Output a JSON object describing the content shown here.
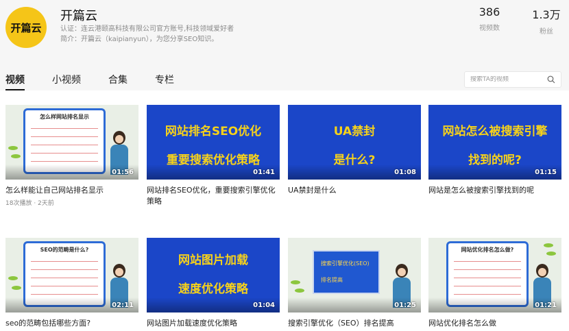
{
  "profile": {
    "avatar_text": "开篇云",
    "name": "开篇云",
    "certification": "认证：连云港颐高科技有限公司官方账号,科技领域爱好者",
    "intro": "简介：开篇云（kaipianyun），为您分享SEO知识。",
    "stats": [
      {
        "value": "386",
        "label": "视频数"
      },
      {
        "value": "1.3万",
        "label": "粉丝"
      }
    ]
  },
  "tabs": [
    {
      "label": "视频",
      "active": true
    },
    {
      "label": "小视频",
      "active": false
    },
    {
      "label": "合集",
      "active": false
    },
    {
      "label": "专栏",
      "active": false
    }
  ],
  "search": {
    "placeholder": "搜索TA的视频",
    "value": "",
    "icon": "search-icon"
  },
  "videos": [
    {
      "title": "怎么样能让自己网站排名显示",
      "duration": "01:56",
      "meta": "18次播放 · 2天前",
      "thumb": "cartoon",
      "thumb_text": [
        "怎么样网站排名显示"
      ]
    },
    {
      "title": "网站排名SEO优化，重要搜索引擎优化策略",
      "duration": "01:41",
      "meta": "",
      "thumb": "blue",
      "thumb_text": [
        "网站排名SEO优化",
        "重要搜索优化策略"
      ]
    },
    {
      "title": "UA禁封是什么",
      "duration": "01:08",
      "meta": "",
      "thumb": "blue",
      "thumb_text": [
        "UA禁封",
        "是什么?"
      ]
    },
    {
      "title": "网站是怎么被搜索引擎找到的呢",
      "duration": "01:15",
      "meta": "",
      "thumb": "blue",
      "thumb_text": [
        "网站怎么被搜索引擎",
        "找到的呢?"
      ]
    },
    {
      "title": "seo的范畴包括哪些方面?",
      "duration": "02:11",
      "meta": "",
      "thumb": "cartoon",
      "thumb_text": [
        "SEO的范畴是什么?"
      ]
    },
    {
      "title": "网站图片加载速度优化策略",
      "duration": "01:04",
      "meta": "",
      "thumb": "blue",
      "thumb_text": [
        "网站图片加载",
        "速度优化策略"
      ]
    },
    {
      "title": "搜索引擎优化（SEO）排名提高",
      "duration": "01:25",
      "meta": "",
      "thumb": "screen",
      "thumb_text": [
        "搜索引擎优化(SEO)",
        "排名提高"
      ]
    },
    {
      "title": "网站优化排名怎么做",
      "duration": "01:21",
      "meta": "",
      "thumb": "cartoon",
      "thumb_text": [
        "网站优化排名怎么做?"
      ]
    }
  ],
  "colors": {
    "accent": "#f5c518",
    "thumb_blue": "#1b46c8",
    "thumb_text": "#f7d21a"
  }
}
